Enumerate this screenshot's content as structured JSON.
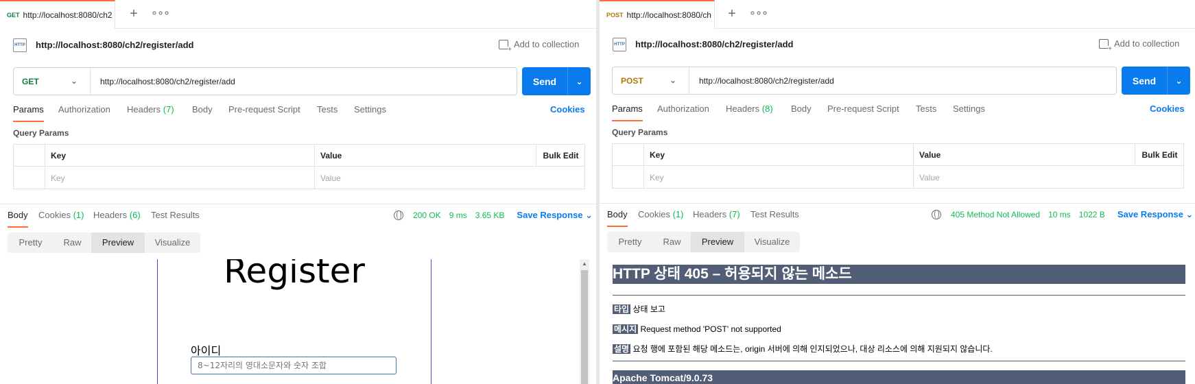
{
  "left": {
    "tab": {
      "method": "GET",
      "url": "http://localhost:8080/ch2"
    },
    "title": "http://localhost:8080/ch2/register/add",
    "add_to_collection": "Add to collection",
    "method": "GET",
    "url": "http://localhost:8080/ch2/register/add",
    "send": "Send",
    "request_tabs": {
      "params": "Params",
      "authorization": "Authorization",
      "headers": "Headers",
      "headers_count": "(7)",
      "body": "Body",
      "pre_request": "Pre-request Script",
      "tests": "Tests",
      "settings": "Settings"
    },
    "cookies": "Cookies",
    "query_params": "Query Params",
    "table": {
      "key": "Key",
      "value": "Value",
      "bulk": "Bulk Edit",
      "key_ph": "Key",
      "value_ph": "Value"
    },
    "response_tabs": {
      "body": "Body",
      "cookies": "Cookies",
      "cookies_count": "(1)",
      "headers": "Headers",
      "headers_count": "(6)",
      "tests": "Test Results"
    },
    "status": "200 OK",
    "time": "9 ms",
    "size": "3.65 KB",
    "save_response": "Save Response",
    "views": [
      "Pretty",
      "Raw",
      "Preview",
      "Visualize"
    ],
    "preview": {
      "title": "Register",
      "label": "아이디",
      "placeholder": "8~12자리의 영대소문자와 숫자 조합"
    }
  },
  "right": {
    "tab": {
      "method": "POST",
      "url": "http://localhost:8080/ch"
    },
    "title": "http://localhost:8080/ch2/register/add",
    "add_to_collection": "Add to collection",
    "method": "POST",
    "url": "http://localhost:8080/ch2/register/add",
    "send": "Send",
    "request_tabs": {
      "params": "Params",
      "authorization": "Authorization",
      "headers": "Headers",
      "headers_count": "(8)",
      "body": "Body",
      "pre_request": "Pre-request Script",
      "tests": "Tests",
      "settings": "Settings"
    },
    "cookies": "Cookies",
    "query_params": "Query Params",
    "table": {
      "key": "Key",
      "value": "Value",
      "bulk": "Bulk Edit",
      "key_ph": "Key",
      "value_ph": "Value"
    },
    "response_tabs": {
      "body": "Body",
      "cookies": "Cookies",
      "cookies_count": "(1)",
      "headers": "Headers",
      "headers_count": "(7)",
      "tests": "Test Results"
    },
    "status": "405 Method Not Allowed",
    "time": "10 ms",
    "size": "1022 B",
    "save_response": "Save Response",
    "views": [
      "Pretty",
      "Raw",
      "Preview",
      "Visualize"
    ],
    "preview": {
      "heading": "HTTP 상태 405 – 허용되지 않는 메소드",
      "type_label": "타입",
      "type_value": "상태 보고",
      "msg_label": "메시지",
      "msg_value": "Request method 'POST' not supported",
      "desc_label": "설명",
      "desc_value": "요청 행에 포함된 해당 메소드는, origin 서버에 의해 인지되었으나, 대상 리소스에 의해 지원되지 않습니다.",
      "footer": "Apache Tomcat/9.0.73"
    }
  },
  "colors": {
    "accent": "#ff6c37",
    "send": "#097bed",
    "get": "#0d7d3c",
    "post": "#ad7a03",
    "ok": "#0cbb52",
    "tomcat": "#525d76"
  }
}
